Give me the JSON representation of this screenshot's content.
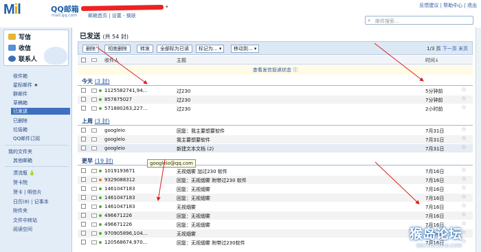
{
  "header": {
    "logo_main": "M",
    "logo_mid": "i",
    "logo_end": "l",
    "brand": "QQ邮箱",
    "domain": "mail.qq.com",
    "caret": "▾",
    "links": "邮箱首页 | 设置 - 换肤",
    "right_links": "反馈建议 | 帮助中心 | 退出",
    "search_placeholder": "邮件搜索..."
  },
  "sidebar": {
    "write": "写信",
    "receive": "收信",
    "contacts": "联系人",
    "folders": [
      "收件箱",
      "星标邮件 ★",
      "群邮件",
      "草稿箱",
      "已发送",
      "已删除",
      "垃圾箱",
      "QQ邮件订阅"
    ],
    "myfolders": "我的文件夹",
    "other": "其他邮箱",
    "tools": [
      "漂流瓶 🍐",
      "贺卡院",
      "贺卡 | 明信片",
      "日历(8) | 记事本",
      "附件夹",
      "文件中转站",
      "阅读空间"
    ]
  },
  "main": {
    "title": "已发送",
    "count": "(共 54 封)",
    "toolbar": {
      "delete": "删除",
      "perm_delete": "彻底删除",
      "forward": "转发",
      "mark_all": "全部标为已读",
      "mark_as": "标记为... ▾",
      "move_to": "移动到... ▾",
      "page": "1/3 页",
      "next": "下一页",
      "last": "末页"
    },
    "columns": {
      "to": "收件人",
      "subject": "主题",
      "time": "时间↓"
    },
    "notice": "查看发信投递状态 ⓘ",
    "groups": [
      {
        "name": "今天",
        "count": "(3 封)"
      },
      {
        "name": "上周",
        "count": "(3 封)"
      },
      {
        "name": "更早",
        "count": "(19 封)"
      }
    ],
    "rows": [
      {
        "to": "1125582741,94...",
        "subject": "过230",
        "time": "5分钟前"
      },
      {
        "to": "857875027",
        "subject": "过230",
        "time": "7分钟前"
      },
      {
        "to": "571880263,227...",
        "subject": "过230",
        "time": "2小时前"
      },
      {
        "to": "googleio",
        "subject": "回复：我主要想要软件",
        "time": "7月31日"
      },
      {
        "to": "googleio",
        "subject": "我主要想要软件",
        "time": "7月31日"
      },
      {
        "to": "googleio",
        "subject": "新建文本文档 (2)",
        "time": "7月31日"
      },
      {
        "to": "1019193671",
        "subject": "无视烟雾 加过230 软件",
        "time": "7月16日"
      },
      {
        "to": "9329088312",
        "subject": "回复：无视烟雾 附带过230 软件",
        "time": "7月16日"
      },
      {
        "to": "1461047183",
        "subject": "回复：无视烟雾",
        "time": "7月16日"
      },
      {
        "to": "1461047183",
        "subject": "回复：无视烟雾",
        "time": "7月16日"
      },
      {
        "to": "1461047183",
        "subject": "无视烟雾",
        "time": "7月16日"
      },
      {
        "to": "496671226",
        "subject": "回复：无视烟雾",
        "time": "7月16日"
      },
      {
        "to": "496671226",
        "subject": "回复：无视烟雾",
        "time": "7月16日"
      },
      {
        "to": "970905896,104...",
        "subject": "无视烟雾",
        "time": "7月16日"
      },
      {
        "to": "120568674,970...",
        "subject": "回复：无视烟雾 附带过230软件",
        "time": "7月16日"
      }
    ],
    "tooltip": "googleio@qq.com"
  },
  "watermark": {
    "big": "猴岛论坛",
    "small": "BBS.HOUDAO.COM"
  },
  "colors": {
    "accent": "#1d5ea6",
    "selected": "#3d6fbf",
    "arrow": "#e11b1b"
  }
}
